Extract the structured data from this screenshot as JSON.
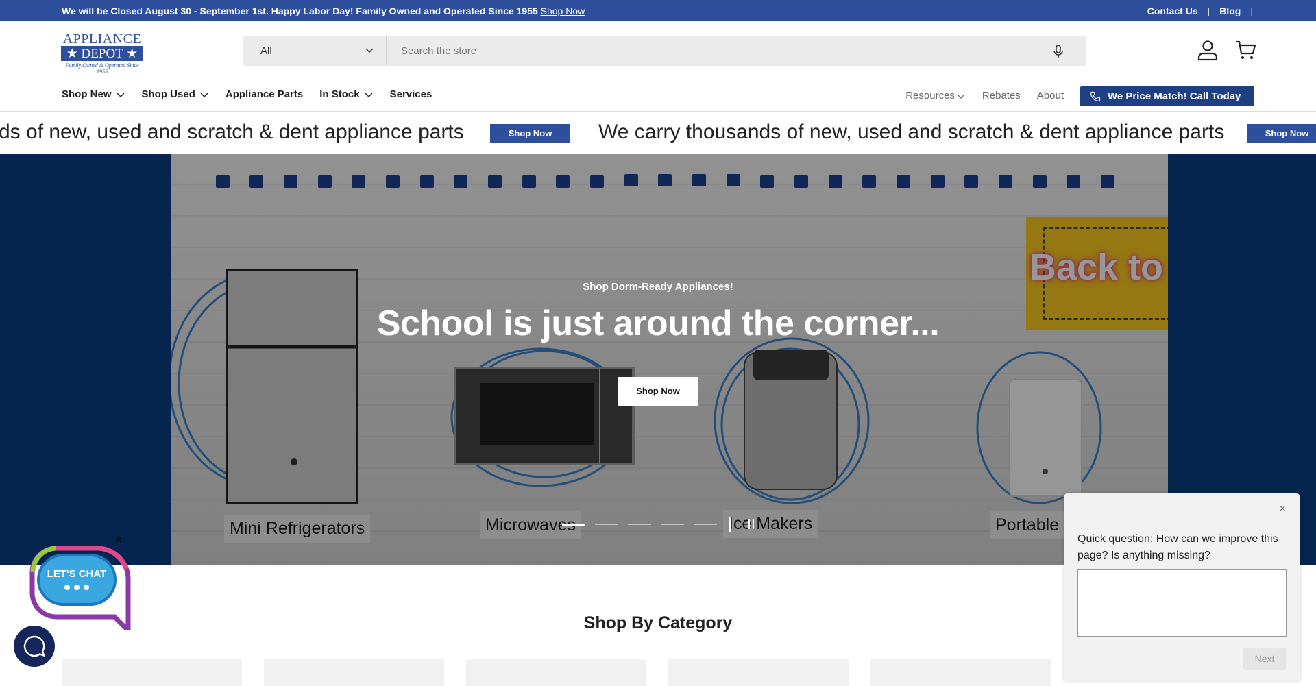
{
  "announcement": {
    "message": "We will be Closed August 30 - September 1st. Happy Labor Day! Family Owned and Operated Since 1955",
    "link": "Shop Now",
    "links": [
      "Contact Us",
      "Blog"
    ],
    "separator": "|"
  },
  "logo": {
    "line1": "APPLIANCE",
    "line2": "★ DEPOT ★",
    "tagline": "Family Owned & Operated Since 1955"
  },
  "search": {
    "category": "All",
    "placeholder": "Search the store"
  },
  "nav": {
    "left": [
      "Shop New",
      "Shop Used",
      "Appliance Parts",
      "In Stock",
      "Services"
    ],
    "right": [
      "Resources",
      "Rebates",
      "About"
    ],
    "price_match": "We Price Match! Call Today"
  },
  "ticker": {
    "fragment": "ds of new, used and scratch & dent appliance parts",
    "text": "We carry thousands of new, used and scratch & dent appliance parts",
    "button": "Shop Now"
  },
  "hero": {
    "subtitle": "Shop Dorm-Ready Appliances!",
    "title": "School is just around the corner...",
    "button": "Shop Now",
    "banner": "Back to School",
    "labels": [
      "Mini Refrigerators",
      "Microwaves",
      "Ice Makers",
      "Portable"
    ],
    "slide_count": 5,
    "active_slide": 1
  },
  "category": {
    "title": "Shop By Category"
  },
  "chat": {
    "bubble": "LET'S CHAT"
  },
  "survey": {
    "close": "×",
    "question": "Quick question: How can we improve this page? Is anything missing?",
    "next": "Next"
  },
  "colors": {
    "brand": "#2e4f9b",
    "hero_bg": "#06254e",
    "price_match": "#1f3f85"
  }
}
